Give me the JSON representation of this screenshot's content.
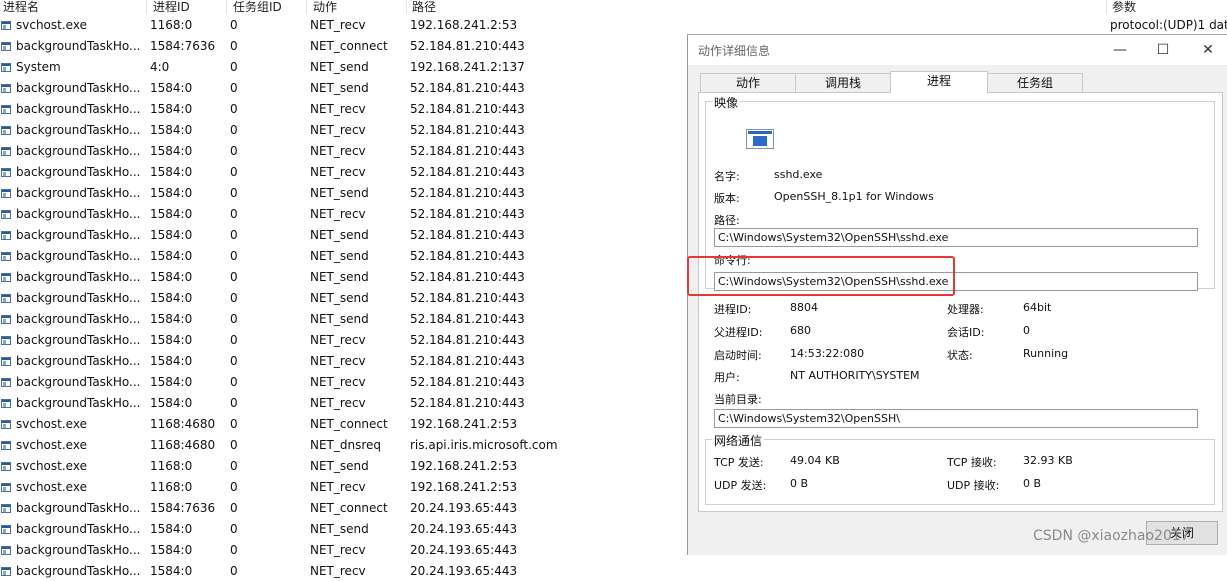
{
  "columns": [
    "进程名",
    "进程ID",
    "任务组ID",
    "动作",
    "路径",
    "参数"
  ],
  "param_text": "protocol:(UDP)1 dat",
  "rows": [
    [
      "svchost.exe",
      "1168:0",
      "0",
      "NET_recv",
      "192.168.241.2:53"
    ],
    [
      "backgroundTaskHo...",
      "1584:7636",
      "0",
      "NET_connect",
      "52.184.81.210:443"
    ],
    [
      "System",
      "4:0",
      "0",
      "NET_send",
      "192.168.241.2:137"
    ],
    [
      "backgroundTaskHo...",
      "1584:0",
      "0",
      "NET_send",
      "52.184.81.210:443"
    ],
    [
      "backgroundTaskHo...",
      "1584:0",
      "0",
      "NET_recv",
      "52.184.81.210:443"
    ],
    [
      "backgroundTaskHo...",
      "1584:0",
      "0",
      "NET_recv",
      "52.184.81.210:443"
    ],
    [
      "backgroundTaskHo...",
      "1584:0",
      "0",
      "NET_recv",
      "52.184.81.210:443"
    ],
    [
      "backgroundTaskHo...",
      "1584:0",
      "0",
      "NET_recv",
      "52.184.81.210:443"
    ],
    [
      "backgroundTaskHo...",
      "1584:0",
      "0",
      "NET_send",
      "52.184.81.210:443"
    ],
    [
      "backgroundTaskHo...",
      "1584:0",
      "0",
      "NET_recv",
      "52.184.81.210:443"
    ],
    [
      "backgroundTaskHo...",
      "1584:0",
      "0",
      "NET_send",
      "52.184.81.210:443"
    ],
    [
      "backgroundTaskHo...",
      "1584:0",
      "0",
      "NET_send",
      "52.184.81.210:443"
    ],
    [
      "backgroundTaskHo...",
      "1584:0",
      "0",
      "NET_send",
      "52.184.81.210:443"
    ],
    [
      "backgroundTaskHo...",
      "1584:0",
      "0",
      "NET_send",
      "52.184.81.210:443"
    ],
    [
      "backgroundTaskHo...",
      "1584:0",
      "0",
      "NET_send",
      "52.184.81.210:443"
    ],
    [
      "backgroundTaskHo...",
      "1584:0",
      "0",
      "NET_recv",
      "52.184.81.210:443"
    ],
    [
      "backgroundTaskHo...",
      "1584:0",
      "0",
      "NET_recv",
      "52.184.81.210:443"
    ],
    [
      "backgroundTaskHo...",
      "1584:0",
      "0",
      "NET_recv",
      "52.184.81.210:443"
    ],
    [
      "backgroundTaskHo...",
      "1584:0",
      "0",
      "NET_recv",
      "52.184.81.210:443"
    ],
    [
      "svchost.exe",
      "1168:4680",
      "0",
      "NET_connect",
      "192.168.241.2:53"
    ],
    [
      "svchost.exe",
      "1168:4680",
      "0",
      "NET_dnsreq",
      "ris.api.iris.microsoft.com"
    ],
    [
      "svchost.exe",
      "1168:0",
      "0",
      "NET_send",
      "192.168.241.2:53"
    ],
    [
      "svchost.exe",
      "1168:0",
      "0",
      "NET_recv",
      "192.168.241.2:53"
    ],
    [
      "backgroundTaskHo...",
      "1584:7636",
      "0",
      "NET_connect",
      "20.24.193.65:443"
    ],
    [
      "backgroundTaskHo...",
      "1584:0",
      "0",
      "NET_send",
      "20.24.193.65:443"
    ],
    [
      "backgroundTaskHo...",
      "1584:0",
      "0",
      "NET_recv",
      "20.24.193.65:443"
    ],
    [
      "backgroundTaskHo...",
      "1584:0",
      "0",
      "NET_recv",
      "20.24.193.65:443"
    ]
  ],
  "dialog": {
    "title": "动作详细信息",
    "minimize": "—",
    "maximize": "☐",
    "close": "✕",
    "tabs": [
      "动作",
      "调用栈",
      "进程",
      "任务组"
    ],
    "image_group": "映像",
    "name_label": "名字:",
    "name_value": "sshd.exe",
    "version_label": "版本:",
    "version_value": "OpenSSH_8.1p1 for Windows",
    "path_label": "路径:",
    "path_value": "C:\\Windows\\System32\\OpenSSH\\sshd.exe",
    "cmdline_label": "命令行:",
    "cmdline_value": "C:\\Windows\\System32\\OpenSSH\\sshd.exe",
    "pid_label": "进程ID:",
    "pid_value": "8804",
    "ppid_label": "父进程ID:",
    "ppid_value": "680",
    "start_label": "启动时间:",
    "start_value": "14:53:22:080",
    "user_label": "用户:",
    "user_value": "NT AUTHORITY\\SYSTEM",
    "cpu_label": "处理器:",
    "cpu_value": "64bit",
    "session_label": "会话ID:",
    "session_value": "0",
    "state_label": "状态:",
    "state_value": "Running",
    "cwd_label": "当前目录:",
    "cwd_value": "C:\\Windows\\System32\\OpenSSH\\",
    "net_group": "网络通信",
    "tcp_send_label": "TCP 发送:",
    "tcp_send_value": "49.04 KB",
    "tcp_recv_label": "TCP 接收:",
    "tcp_recv_value": "32.93 KB",
    "udp_send_label": "UDP 发送:",
    "udp_send_value": "0 B",
    "udp_recv_label": "UDP 接收:",
    "udp_recv_value": "0 B",
    "close_button": "关闭"
  },
  "watermark": "CSDN @xiaozhao2017"
}
